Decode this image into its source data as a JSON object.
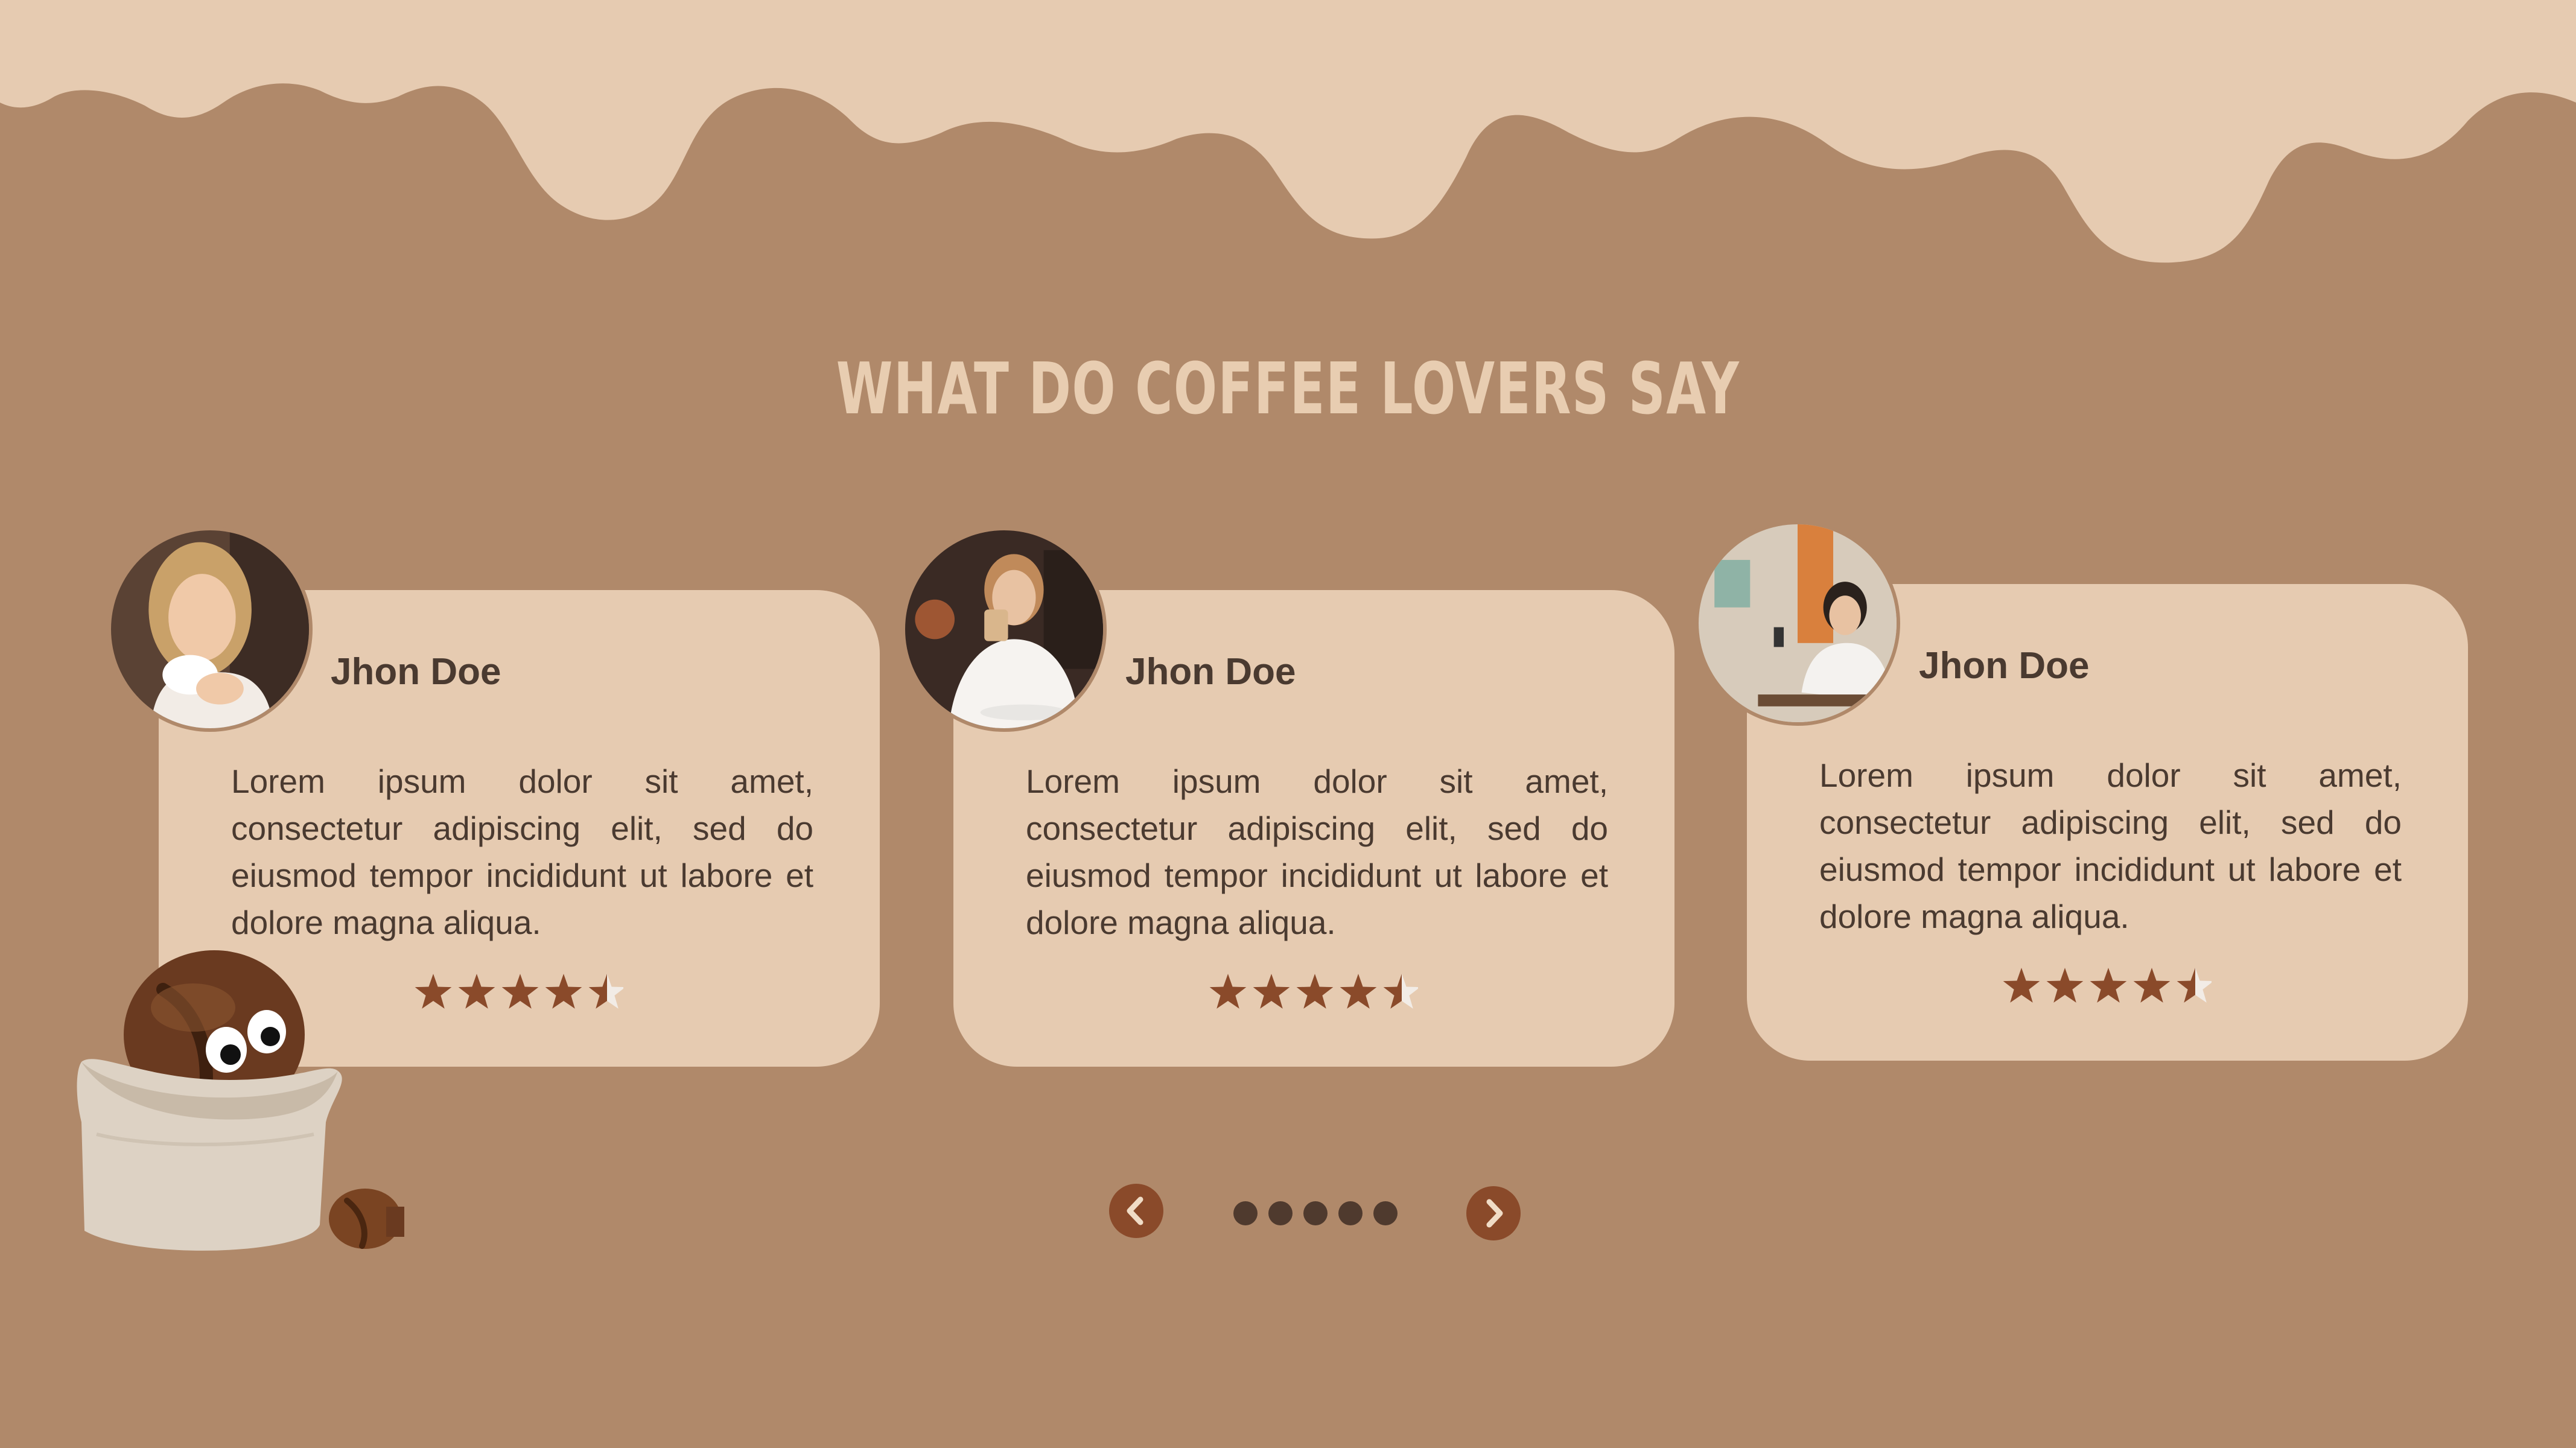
{
  "page": {
    "title": "WHAT DO COFFEE LOVERS SAY",
    "colors": {
      "background": "#b0896a",
      "cream": "#e6cbb1",
      "text": "#4a3a30",
      "accent": "#8a4a2a",
      "star": "#8a4a2a"
    }
  },
  "testimonials": [
    {
      "name": "Jhon Doe",
      "text": "Lorem ipsum dolor sit amet, consectetur adipiscing elit, sed do eiusmod tempor incididunt ut labore et dolore magna aliqua.",
      "rating": 4.5,
      "rating_max": 5,
      "avatar_icon": "woman-with-cup-photo"
    },
    {
      "name": "Jhon Doe",
      "text": "Lorem ipsum dolor sit amet, consectetur adipiscing elit, sed do eiusmod tempor incididunt ut labore et dolore magna aliqua.",
      "rating": 4.5,
      "rating_max": 5,
      "avatar_icon": "woman-drinking-latte-photo"
    },
    {
      "name": "Jhon Doe",
      "text": "Lorem ipsum dolor sit amet, consectetur adipiscing elit, sed do eiusmod tempor incididunt ut labore et dolore magna aliqua.",
      "rating": 4.5,
      "rating_max": 5,
      "avatar_icon": "woman-in-cafe-photo"
    }
  ],
  "carousel": {
    "prev_icon": "chevron-left-icon",
    "next_icon": "chevron-right-icon",
    "dot_count": 5
  },
  "decoration": {
    "mascot_icon": "coffee-bean-sack-mascot"
  }
}
